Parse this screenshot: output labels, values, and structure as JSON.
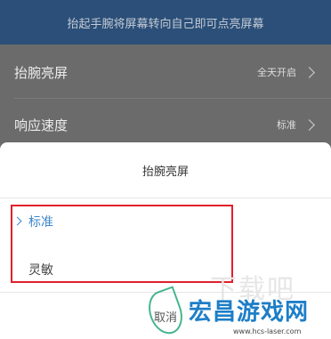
{
  "banner": {
    "text": "抬起手腕将屏幕转向自己即可点亮屏幕"
  },
  "settings": {
    "rows": [
      {
        "label": "抬腕亮屏",
        "value": "全天开启"
      },
      {
        "label": "响应速度",
        "value": "标准"
      }
    ]
  },
  "dialog": {
    "title": "抬腕亮屏",
    "options": [
      {
        "label": "标准",
        "selected": true
      },
      {
        "label": "灵敏",
        "selected": false
      }
    ],
    "cancel_label": "取消"
  },
  "watermark": {
    "ghost_text": "下载吧",
    "brand_text": "宏昌游戏网",
    "url_text": "www.hcs-laser.com"
  },
  "colors": {
    "accent": "#3f86c9",
    "highlight": "#e0202a",
    "banner": "#2b4f78"
  }
}
